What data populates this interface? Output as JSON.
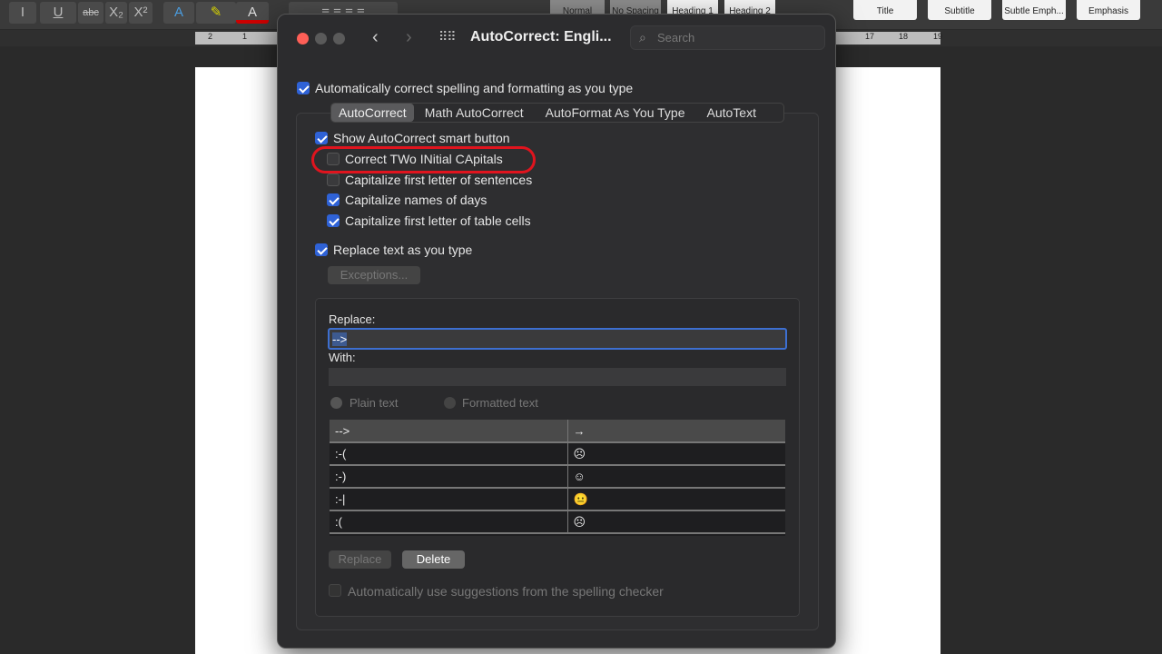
{
  "toolbar": {
    "format_buttons": [
      "I",
      "U",
      "abc",
      "X₂",
      "X²",
      "A",
      "A"
    ],
    "styles": [
      "Normal",
      "No Spacing",
      "Heading 1",
      "Heading 2",
      "Title",
      "Subtitle",
      "Subtle Emph...",
      "Emphasis"
    ]
  },
  "ruler": {
    "left_ticks": [
      "2",
      "1"
    ],
    "right_ticks": [
      "17",
      "18",
      "19"
    ]
  },
  "dialog": {
    "title": "AutoCorrect: Engli...",
    "search_placeholder": "Search",
    "auto_correct_master": {
      "label": "Automatically correct spelling and formatting as you type",
      "checked": true
    },
    "tabs": [
      "AutoCorrect",
      "Math AutoCorrect",
      "AutoFormat As You Type",
      "AutoText"
    ],
    "active_tab": "AutoCorrect",
    "options": [
      {
        "label": "Show AutoCorrect smart button",
        "checked": true
      },
      {
        "label": "Correct TWo INitial CApitals",
        "checked": false
      },
      {
        "label": "Capitalize first letter of sentences",
        "checked": false
      },
      {
        "label": "Capitalize names of days",
        "checked": true
      },
      {
        "label": "Capitalize first letter of table cells",
        "checked": true
      },
      {
        "label": "Replace text as you type",
        "checked": true
      }
    ],
    "exceptions_label": "Exceptions...",
    "replace_label": "Replace:",
    "replace_value": "-->",
    "with_label": "With:",
    "with_value": "",
    "plain_text": "Plain text",
    "formatted_text": "Formatted text",
    "entries": [
      {
        "from": "-->",
        "to": "→"
      },
      {
        "from": ":-(",
        "to": "☹"
      },
      {
        "from": ":-)",
        "to": "☺"
      },
      {
        "from": ":-|",
        "to": "😐"
      },
      {
        "from": ":(",
        "to": "☹"
      }
    ],
    "replace_button": "Replace",
    "delete_button": "Delete",
    "spelling_suggestions": {
      "label": "Automatically use suggestions from the spelling checker",
      "checked": false
    },
    "highlight_color": "#e0141e"
  }
}
